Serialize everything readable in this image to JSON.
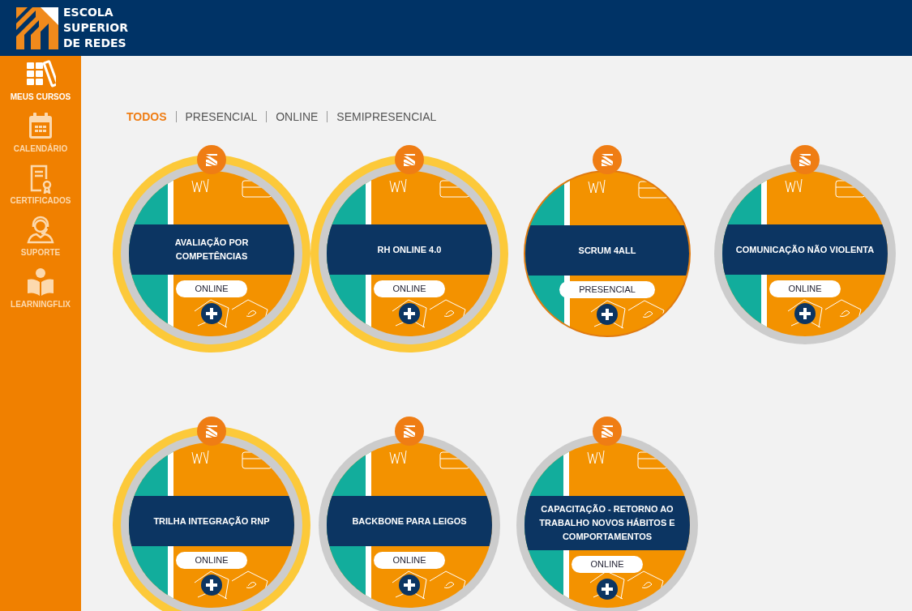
{
  "header": {
    "brand": [
      "ESCOLA",
      "SUPERIOR",
      "DE REDES"
    ]
  },
  "sidebar": {
    "items": [
      {
        "kind": "courses",
        "label": "MEUS CURSOS",
        "selected": true
      },
      {
        "kind": "calendar",
        "label": "CALENDÁRIO",
        "selected": false
      },
      {
        "kind": "certificate",
        "label": "CERTIFICADOS",
        "selected": false
      },
      {
        "kind": "support",
        "label": "SUPORTE",
        "selected": false
      },
      {
        "kind": "reader",
        "label": "LEARNINGFLIX",
        "selected": false
      }
    ]
  },
  "filters": [
    {
      "label": "TODOS",
      "selected": true
    },
    {
      "label": "PRESENCIAL",
      "selected": false
    },
    {
      "label": "ONLINE",
      "selected": false
    },
    {
      "label": "SEMIPRESENCIAL",
      "selected": false
    }
  ],
  "courses": [
    {
      "title": "AVALIAÇÃO POR COMPETÊNCIAS",
      "mode": "ONLINE",
      "highlighted": true,
      "grey_ring": true
    },
    {
      "title": "RH ONLINE 4.0",
      "mode": "ONLINE",
      "highlighted": true,
      "grey_ring": true
    },
    {
      "title": "SCRUM 4ALL",
      "mode": "PRESENCIAL",
      "highlighted": false,
      "grey_ring": false
    },
    {
      "title": "COMUNICAÇÃO NÃO VIOLENTA",
      "mode": "ONLINE",
      "highlighted": false,
      "grey_ring": true
    },
    {
      "title": "TRILHA INTEGRAÇÃO RNP",
      "mode": "ONLINE",
      "highlighted": true,
      "grey_ring": true
    },
    {
      "title": "BACKBONE PARA LEIGOS",
      "mode": "ONLINE",
      "highlighted": false,
      "grey_ring": true
    },
    {
      "title": "CAPACITAÇÃO - RETORNO AO TRABALHO NOVOS HÁBITOS E COMPORTAMENTOS",
      "mode": "ONLINE",
      "highlighted": false,
      "grey_ring": true
    }
  ]
}
